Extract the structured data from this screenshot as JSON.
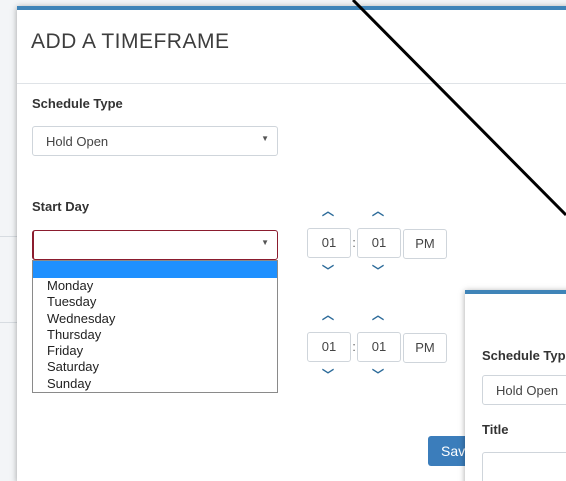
{
  "modal": {
    "title": "ADD A TIMEFRAME",
    "schedule_type": {
      "label": "Schedule Type",
      "value": "Hold Open"
    },
    "start_day": {
      "label": "Start Day",
      "value": "",
      "options": [
        "Monday",
        "Tuesday",
        "Wednesday",
        "Thursday",
        "Friday",
        "Saturday",
        "Sunday"
      ]
    },
    "start_time": {
      "hour": "01",
      "minute": "01",
      "ampm": "PM"
    },
    "end_time": {
      "hour": "01",
      "minute": "01",
      "ampm": "PM"
    },
    "time_separator": ":",
    "save_label": "Save"
  },
  "second_modal": {
    "schedule_type_label": "Schedule Type",
    "schedule_type_value": "Hold Open",
    "title_label": "Title"
  },
  "colors": {
    "accent": "#3f84b8",
    "button": "#3b7dbb",
    "dropdown_highlight": "#1e90ff",
    "invalid_border": "#8b1c2e"
  }
}
